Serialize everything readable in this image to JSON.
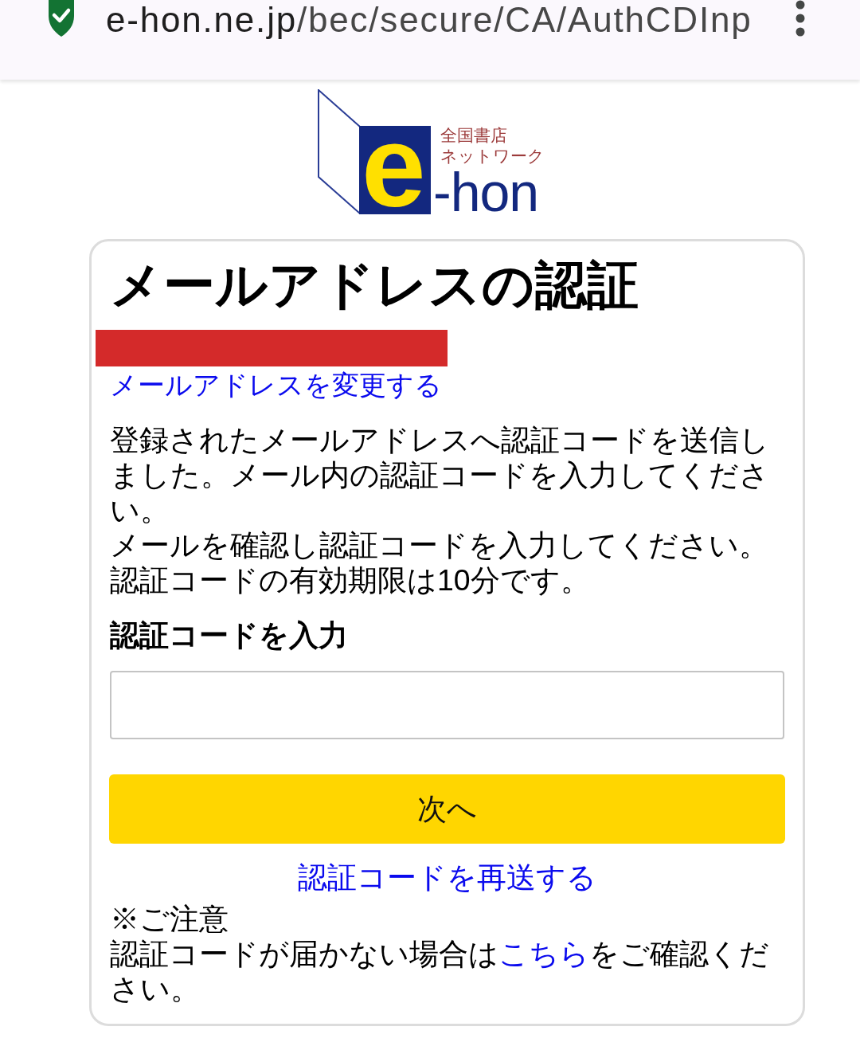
{
  "browser": {
    "url": {
      "host": "e-hon.ne.jp",
      "path": "/bec/secure/CA/AuthCDInp"
    }
  },
  "logo": {
    "letter": "e",
    "wordmark": "-hon",
    "tagline": [
      "全国書店",
      "ネットワーク"
    ]
  },
  "card": {
    "title": "メールアドレスの認証",
    "email": {
      "redacted": true
    },
    "change_email_link": "メールアドレスを変更する",
    "message": [
      "登録されたメールアドレスへ認証コードを送信しました。メール内の認証コードを入力してください。",
      "メールを確認し認証コードを入力してください。",
      "認証コードの有効期限は10分です。"
    ],
    "code_field": {
      "label": "認証コードを入力"
    },
    "next_button": "次へ",
    "resend_link": "認証コードを再送する",
    "notice": {
      "heading": "※ご注意",
      "text_before": "認証コードが届かない場合は",
      "link": "こちら",
      "text_after": "をご確認ください。"
    }
  }
}
